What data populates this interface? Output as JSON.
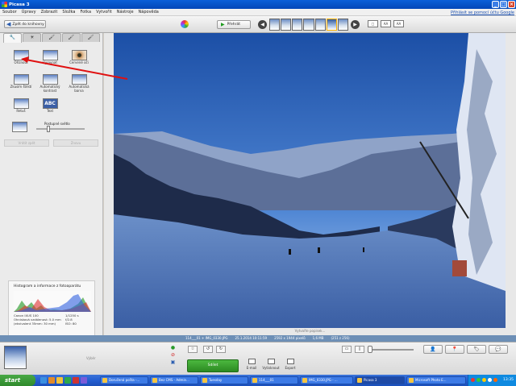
{
  "window": {
    "title": "Picasa 3"
  },
  "menu": {
    "items": [
      "Soubor",
      "Úpravy",
      "Zobrazit",
      "Složka",
      "Fotka",
      "Vytvořit",
      "Nástroje",
      "Nápověda"
    ],
    "signin_link": "Přihlásit se pomocí účtu Google"
  },
  "toolbar": {
    "back_label": "Zpět do knihovny",
    "play_label": "Přehrát",
    "view_modes": [
      "□",
      "AA",
      "AA"
    ]
  },
  "edit_panel": {
    "tabs": [
      "🔧",
      "☀",
      "🖌",
      "🖌",
      "🖌"
    ],
    "tools": [
      {
        "label": "Oříznout"
      },
      {
        "label": "Vyrovnat"
      },
      {
        "label": "Červené oči"
      },
      {
        "label": "Zkusím štěstí"
      },
      {
        "label": "Automatický kontrast"
      },
      {
        "label": "Automatická barva"
      },
      {
        "label": "Retuš"
      },
      {
        "label": "Text"
      }
    ],
    "fill_light_label": "Postupné světlo",
    "fill_light_value": 0.25,
    "undo_label": "Vrátit zpět",
    "redo_label": "Znovu"
  },
  "histogram": {
    "title": "Histogram a informace z fotoaparátu",
    "camera": "Canon IXUS 100",
    "focal_label": "Ohnisková vzdálenost: 5.0 mm",
    "equiv_label": "(ekvivalent 35mm: 30 mm)",
    "shutter": "1/1250 s",
    "aperture": "f/2.8",
    "iso": "ISO: 80"
  },
  "photo": {
    "caption": "Vytvořte popisek..."
  },
  "status_bar": {
    "file": "114___01 + IMG_0330.JPG",
    "date": "25.1.2014 10:11:59",
    "dimensions": "2592 x 1944 pixelů",
    "size": "1,6 MB",
    "position": "(251 z 256)"
  },
  "tray": {
    "selection_label": "Výběr",
    "share_label": "Sdílet",
    "actions": [
      "E-mail",
      "Vytisknout",
      "Export"
    ]
  },
  "taskbar": {
    "start_label": "start",
    "items": [
      "Doručená pošta -...",
      "Bez CMS - Admin...",
      "Tuesday",
      "114___01",
      "IMG_0330.JPG - ...",
      "Picasa 3",
      "Microsoft Photo E..."
    ],
    "active_index": 5,
    "clock": "13:35"
  },
  "colors": {
    "accent": "#0a5fd8",
    "share_green": "#2c8a22",
    "annotation_red": "#e01010"
  }
}
